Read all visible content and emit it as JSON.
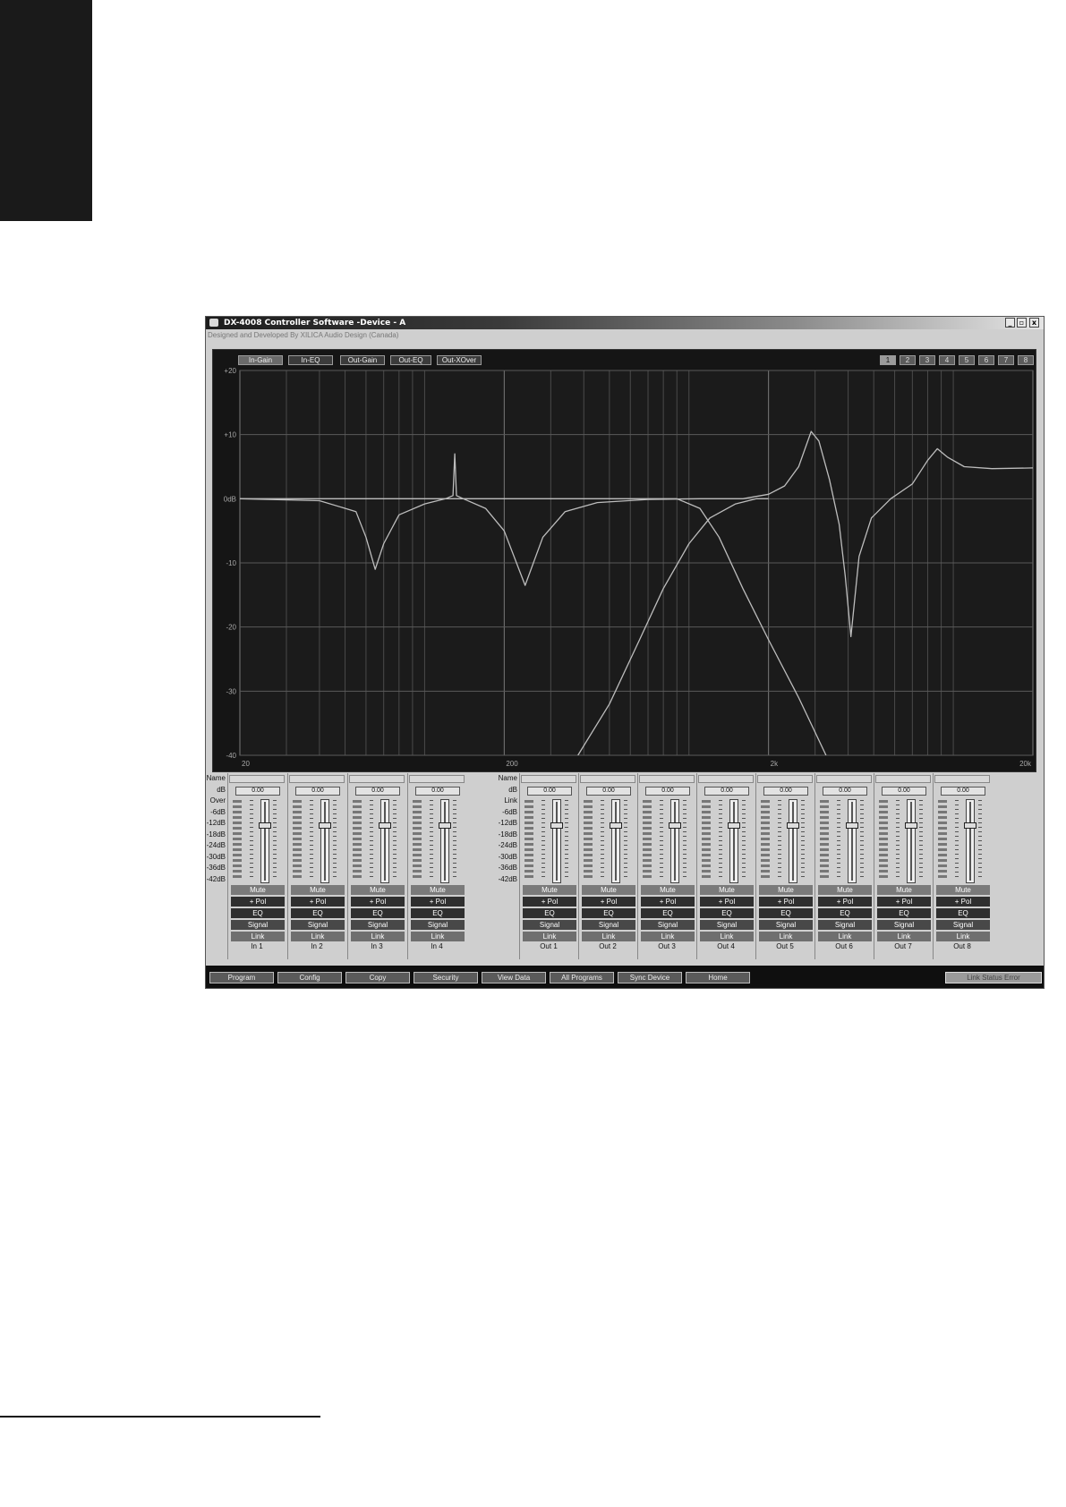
{
  "window": {
    "title": "DX-4008 Controller Software -Device - A",
    "subtitle": "Designed and Developed By XILICA Audio Design (Canada)",
    "controls": [
      "_",
      "▫",
      "x"
    ]
  },
  "graph_tabs": [
    {
      "label": "In-Gain",
      "active": true
    },
    {
      "label": "In-EQ",
      "active": false
    },
    {
      "label": "Out-Gain",
      "active": false
    },
    {
      "label": "Out-EQ",
      "active": false
    },
    {
      "label": "Out-XOver",
      "active": false
    }
  ],
  "output_numbers": [
    "1",
    "2",
    "3",
    "4",
    "5",
    "6",
    "7",
    "8"
  ],
  "chart_data": {
    "type": "line",
    "xscale": "log",
    "xlim": [
      20,
      20000
    ],
    "ylim": [
      -40,
      20
    ],
    "x_tick_labels": [
      "20",
      "200",
      "2k",
      "20k"
    ],
    "y_tick_labels": [
      "+20",
      "+10",
      "0dB",
      "-10",
      "-20",
      "-30",
      "-40"
    ],
    "grid": true,
    "series": [
      {
        "points": [
          [
            20,
            0
          ],
          [
            40,
            -0.3
          ],
          [
            55,
            -2
          ],
          [
            60,
            -6
          ],
          [
            65,
            -11
          ],
          [
            70,
            -7
          ],
          [
            80,
            -2.5
          ],
          [
            100,
            -0.8
          ],
          [
            120,
            0
          ],
          [
            128,
            0.5
          ],
          [
            130,
            7
          ],
          [
            132,
            0.5
          ],
          [
            140,
            0
          ],
          [
            170,
            -1.5
          ],
          [
            200,
            -5
          ],
          [
            240,
            -13.5
          ],
          [
            280,
            -6
          ],
          [
            340,
            -2
          ],
          [
            450,
            -0.6
          ],
          [
            700,
            -0.1
          ],
          [
            1100,
            0
          ],
          [
            1600,
            0
          ],
          [
            2000,
            0.7
          ],
          [
            2300,
            2
          ],
          [
            2600,
            5
          ],
          [
            2900,
            10.5
          ],
          [
            3100,
            9
          ],
          [
            3400,
            3
          ],
          [
            3700,
            -4
          ],
          [
            3900,
            -12
          ],
          [
            4100,
            -21.5
          ],
          [
            4400,
            -9
          ],
          [
            4900,
            -3
          ],
          [
            5800,
            0
          ],
          [
            7000,
            2.3
          ],
          [
            8000,
            6
          ],
          [
            8700,
            7.8
          ],
          [
            9500,
            6.5
          ],
          [
            11000,
            5
          ],
          [
            14000,
            4.7
          ],
          [
            20000,
            4.8
          ]
        ]
      },
      {
        "points": [
          [
            380,
            -40
          ],
          [
            500,
            -32
          ],
          [
            650,
            -22
          ],
          [
            800,
            -14
          ],
          [
            1000,
            -7
          ],
          [
            1200,
            -3
          ],
          [
            1500,
            -0.8
          ],
          [
            1800,
            0
          ],
          [
            2000,
            0
          ]
        ]
      },
      {
        "points": [
          [
            20,
            0
          ],
          [
            400,
            0
          ],
          [
            900,
            0
          ],
          [
            1100,
            -1.5
          ],
          [
            1300,
            -6
          ],
          [
            1600,
            -14
          ],
          [
            2000,
            -22
          ],
          [
            2600,
            -31
          ],
          [
            3300,
            -40
          ]
        ]
      }
    ]
  },
  "level_labels_in": [
    "Name",
    "dB",
    "Over",
    "-6dB",
    "-12dB",
    "-18dB",
    "-24dB",
    "-30dB",
    "-36dB",
    "-42dB"
  ],
  "level_labels_out": [
    "Name",
    "dB",
    "Link",
    "-6dB",
    "-12dB",
    "-18dB",
    "-24dB",
    "-30dB",
    "-36dB",
    "-42dB"
  ],
  "buttons": {
    "mute": "Mute",
    "pol": "+ Pol",
    "eq": "EQ",
    "signal": "Signal",
    "link": "Link"
  },
  "inputs": [
    {
      "label": "In 1",
      "db": "0.00",
      "fader": 0.72
    },
    {
      "label": "In 2",
      "db": "0.00",
      "fader": 0.72
    },
    {
      "label": "In 3",
      "db": "0.00",
      "fader": 0.72
    },
    {
      "label": "In 4",
      "db": "0.00",
      "fader": 0.72
    }
  ],
  "outputs": [
    {
      "label": "Out 1",
      "db": "0.00",
      "fader": 0.72
    },
    {
      "label": "Out 2",
      "db": "0.00",
      "fader": 0.72
    },
    {
      "label": "Out 3",
      "db": "0.00",
      "fader": 0.72
    },
    {
      "label": "Out 4",
      "db": "0.00",
      "fader": 0.72
    },
    {
      "label": "Out 5",
      "db": "0.00",
      "fader": 0.72
    },
    {
      "label": "Out 6",
      "db": "0.00",
      "fader": 0.72
    },
    {
      "label": "Out 7",
      "db": "0.00",
      "fader": 0.72
    },
    {
      "label": "Out 8",
      "db": "0.00",
      "fader": 0.72
    }
  ],
  "toolbar": [
    "Program",
    "Config",
    "Copy",
    "Security",
    "View Data",
    "All Programs",
    "Sync Device",
    "Home"
  ],
  "status": "Link Status Error"
}
